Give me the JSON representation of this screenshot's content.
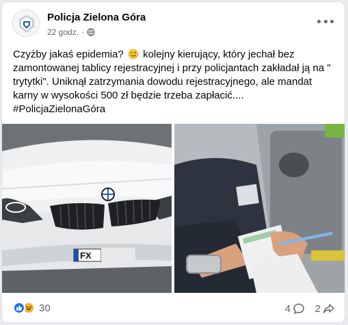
{
  "post": {
    "page_name": "Policja Zielona Góra",
    "time": "22 godz.",
    "separator": "·",
    "text": {
      "line1_a": "Czyżby jakaś epidemia?",
      "line1_b": "kolejny kierujący, który jechał bez",
      "line2": "zamontowanej tablicy rejestracyjnej i przy policjantach zakładał ją na \"",
      "line3": "trytytki\". Uniknął zatrzymania dowodu rejestracyjnego,  ale mandat",
      "line4": "karny w wysokości 500 zł będzie trzeba zapłacić....",
      "line5": "#PolicjaZielonaGóra"
    },
    "emoji": "winking-face-emoji",
    "plate_text": "FX"
  },
  "footer": {
    "reaction_count": "30",
    "comment_count": "4",
    "share_count": "2",
    "reaction_icons": [
      "like-icon",
      "haha-icon"
    ]
  },
  "icons": {
    "more": "more-options-icon",
    "globe": "globe-icon",
    "comment": "comment-icon",
    "share": "share-icon"
  },
  "colors": {
    "accent": "#1877f2",
    "haha": "#f7b125",
    "secondary_text": "#65676b"
  }
}
